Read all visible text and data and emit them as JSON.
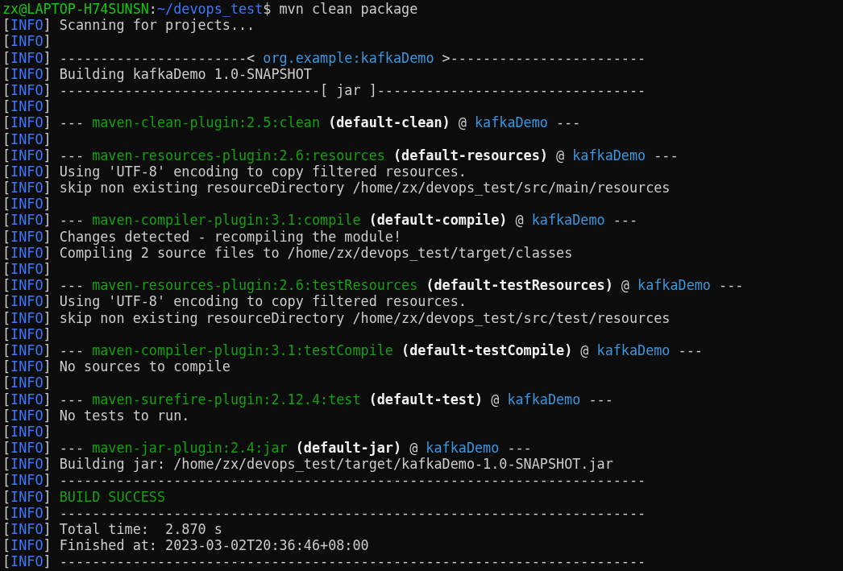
{
  "prompt": {
    "user": "zx@LAPTOP-H74SUNSN",
    "separator": ":",
    "path": "~/devops_test",
    "symbol": "$",
    "command": "mvn clean package"
  },
  "lines": [
    {
      "tag": "[INFO]",
      "segments": [
        {
          "kind": "text",
          "text": "Scanning for projects..."
        }
      ]
    },
    {
      "tag": "[INFO]"
    },
    {
      "tag": "[INFO]",
      "segments": [
        {
          "kind": "text",
          "text": "-----------------------<"
        },
        {
          "kind": "project",
          "text": "org.example:kafkaDemo"
        },
        {
          "kind": "text",
          "text": ">------------------------"
        }
      ]
    },
    {
      "tag": "[INFO]",
      "segments": [
        {
          "kind": "text",
          "text": "Building kafkaDemo 1.0-SNAPSHOT"
        }
      ]
    },
    {
      "tag": "[INFO]",
      "segments": [
        {
          "kind": "text",
          "text": "--------------------------------[ jar ]---------------------------------"
        }
      ]
    },
    {
      "tag": "[INFO]"
    },
    {
      "tag": "[INFO]",
      "segments": [
        {
          "kind": "text",
          "text": "---"
        },
        {
          "kind": "plugin",
          "text": "maven-clean-plugin:2.5:clean"
        },
        {
          "kind": "execution",
          "text": "(default-clean)"
        },
        {
          "kind": "text",
          "text": "@"
        },
        {
          "kind": "project",
          "text": "kafkaDemo"
        },
        {
          "kind": "text",
          "text": "---"
        }
      ]
    },
    {
      "tag": "[INFO]"
    },
    {
      "tag": "[INFO]",
      "segments": [
        {
          "kind": "text",
          "text": "---"
        },
        {
          "kind": "plugin",
          "text": "maven-resources-plugin:2.6:resources"
        },
        {
          "kind": "execution",
          "text": "(default-resources)"
        },
        {
          "kind": "text",
          "text": "@"
        },
        {
          "kind": "project",
          "text": "kafkaDemo"
        },
        {
          "kind": "text",
          "text": "---"
        }
      ]
    },
    {
      "tag": "[INFO]",
      "segments": [
        {
          "kind": "text",
          "text": "Using 'UTF-8' encoding to copy filtered resources."
        }
      ]
    },
    {
      "tag": "[INFO]",
      "segments": [
        {
          "kind": "text",
          "text": "skip non existing resourceDirectory /home/zx/devops_test/src/main/resources"
        }
      ]
    },
    {
      "tag": "[INFO]"
    },
    {
      "tag": "[INFO]",
      "segments": [
        {
          "kind": "text",
          "text": "---"
        },
        {
          "kind": "plugin",
          "text": "maven-compiler-plugin:3.1:compile"
        },
        {
          "kind": "execution",
          "text": "(default-compile)"
        },
        {
          "kind": "text",
          "text": "@"
        },
        {
          "kind": "project",
          "text": "kafkaDemo"
        },
        {
          "kind": "text",
          "text": "---"
        }
      ]
    },
    {
      "tag": "[INFO]",
      "segments": [
        {
          "kind": "text",
          "text": "Changes detected - recompiling the module!"
        }
      ]
    },
    {
      "tag": "[INFO]",
      "segments": [
        {
          "kind": "text",
          "text": "Compiling 2 source files to /home/zx/devops_test/target/classes"
        }
      ]
    },
    {
      "tag": "[INFO]"
    },
    {
      "tag": "[INFO]",
      "segments": [
        {
          "kind": "text",
          "text": "---"
        },
        {
          "kind": "plugin",
          "text": "maven-resources-plugin:2.6:testResources"
        },
        {
          "kind": "execution",
          "text": "(default-testResources)"
        },
        {
          "kind": "text",
          "text": "@"
        },
        {
          "kind": "project",
          "text": "kafkaDemo"
        },
        {
          "kind": "text",
          "text": "---"
        }
      ]
    },
    {
      "tag": "[INFO]",
      "segments": [
        {
          "kind": "text",
          "text": "Using 'UTF-8' encoding to copy filtered resources."
        }
      ]
    },
    {
      "tag": "[INFO]",
      "segments": [
        {
          "kind": "text",
          "text": "skip non existing resourceDirectory /home/zx/devops_test/src/test/resources"
        }
      ]
    },
    {
      "tag": "[INFO]"
    },
    {
      "tag": "[INFO]",
      "segments": [
        {
          "kind": "text",
          "text": "---"
        },
        {
          "kind": "plugin",
          "text": "maven-compiler-plugin:3.1:testCompile"
        },
        {
          "kind": "execution",
          "text": "(default-testCompile)"
        },
        {
          "kind": "text",
          "text": "@"
        },
        {
          "kind": "project",
          "text": "kafkaDemo"
        },
        {
          "kind": "text",
          "text": "---"
        }
      ]
    },
    {
      "tag": "[INFO]",
      "segments": [
        {
          "kind": "text",
          "text": "No sources to compile"
        }
      ]
    },
    {
      "tag": "[INFO]"
    },
    {
      "tag": "[INFO]",
      "segments": [
        {
          "kind": "text",
          "text": "---"
        },
        {
          "kind": "plugin",
          "text": "maven-surefire-plugin:2.12.4:test"
        },
        {
          "kind": "execution",
          "text": "(default-test)"
        },
        {
          "kind": "text",
          "text": "@"
        },
        {
          "kind": "project",
          "text": "kafkaDemo"
        },
        {
          "kind": "text",
          "text": "---"
        }
      ]
    },
    {
      "tag": "[INFO]",
      "segments": [
        {
          "kind": "text",
          "text": "No tests to run."
        }
      ]
    },
    {
      "tag": "[INFO]"
    },
    {
      "tag": "[INFO]",
      "segments": [
        {
          "kind": "text",
          "text": "---"
        },
        {
          "kind": "plugin",
          "text": "maven-jar-plugin:2.4:jar"
        },
        {
          "kind": "execution",
          "text": "(default-jar)"
        },
        {
          "kind": "text",
          "text": "@"
        },
        {
          "kind": "project",
          "text": "kafkaDemo"
        },
        {
          "kind": "text",
          "text": "---"
        }
      ]
    },
    {
      "tag": "[INFO]",
      "segments": [
        {
          "kind": "text",
          "text": "Building jar: /home/zx/devops_test/target/kafkaDemo-1.0-SNAPSHOT.jar"
        }
      ]
    },
    {
      "tag": "[INFO]",
      "segments": [
        {
          "kind": "text",
          "text": "------------------------------------------------------------------------"
        }
      ]
    },
    {
      "tag": "[INFO]",
      "segments": [
        {
          "kind": "success",
          "text": "BUILD SUCCESS"
        }
      ]
    },
    {
      "tag": "[INFO]",
      "segments": [
        {
          "kind": "text",
          "text": "------------------------------------------------------------------------"
        }
      ]
    },
    {
      "tag": "[INFO]",
      "segments": [
        {
          "kind": "text",
          "text": "Total time:  2.870 s"
        }
      ]
    },
    {
      "tag": "[INFO]",
      "segments": [
        {
          "kind": "text",
          "text": "Finished at: 2023-03-02T20:36:46+08:00"
        }
      ]
    },
    {
      "tag": "[INFO]",
      "segments": [
        {
          "kind": "text",
          "text": "------------------------------------------------------------------------"
        }
      ]
    }
  ]
}
